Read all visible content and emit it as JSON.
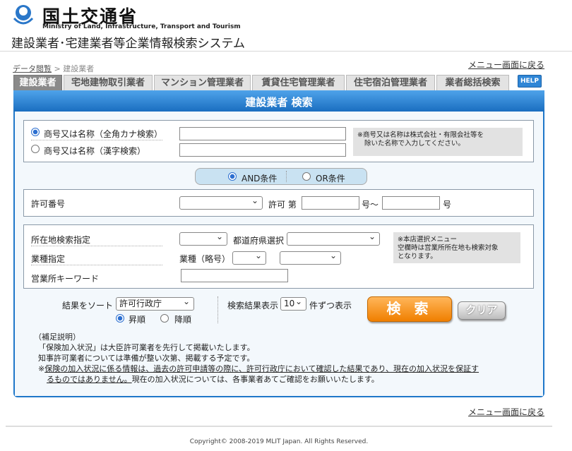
{
  "header": {
    "ministry_name": "国土交通省",
    "ministry_en": "Ministry of Land, Infrastructure, Transport and Tourism",
    "system_title": "建設業者･宅建業者等企業情報検索システム"
  },
  "nav": {
    "menu_link": "メニュー画面に戻る",
    "breadcrumb_root": "データ閲覧",
    "breadcrumb_sep": ">",
    "breadcrumb_current": "建設業者"
  },
  "tabs": [
    {
      "label": "建設業者"
    },
    {
      "label": "宅地建物取引業者"
    },
    {
      "label": "マンション管理業者"
    },
    {
      "label": "賃貸住宅管理業者"
    },
    {
      "label": "住宅宿泊管理業者"
    },
    {
      "label": "業者総括検索"
    }
  ],
  "help_label": "HELP",
  "panel_title": "建設業者 検索",
  "name_search": {
    "kana_label": "商号又は名称（全角カナ検索）",
    "kanji_label": "商号又は名称（漢字検索）",
    "kana_value": "",
    "kanji_value": "",
    "note_line1": "※商号又は名称は株式会社・有限会社等を",
    "note_line2": "除いた名称で入力してください。"
  },
  "condition": {
    "and_label": "AND条件",
    "or_label": "OR条件"
  },
  "permit": {
    "label": "許可番号",
    "select_value": "",
    "prefix": "許可 第",
    "from_value": "",
    "mid": "号〜",
    "to_value": "",
    "suffix": "号"
  },
  "location": {
    "label": "所在地検索指定",
    "pref_label": "都道府県選択",
    "industry_label": "業種指定",
    "industry_abbr_label": "業種（略号）",
    "keyword_label": "営業所キーワード",
    "keyword_value": "",
    "note_line1": "※本店選択メニュー",
    "note_line2": "空欄時は営業所所在地も検索対象",
    "note_line3": "となります。"
  },
  "sort": {
    "label": "結果をソート",
    "value": "許可行政庁",
    "asc_label": "昇順",
    "desc_label": "降順"
  },
  "results": {
    "label": "検索結果表示",
    "value": "10",
    "suffix": "件ずつ表示"
  },
  "buttons": {
    "search": "検 索",
    "clear": "クリア"
  },
  "notes": {
    "heading": "（補足説明）",
    "line1": "「保険加入状況」は大臣許可業者を先行して掲載いたします。",
    "line2": "知事許可業者については準備が整い次第、掲載する予定です。",
    "line3_prefix": "※",
    "line3_underlined": "保険の加入状況に係る情報は、過去の許可申請等の際に、許可行政庁において確認した結果であり、現在の加入状況を保証す",
    "line4_underlined": "るものではありません。",
    "line4_rest": "現在の加入状況については、各事業者あてご確認をお願いいたします。"
  },
  "footer": {
    "copyright": "Copyright© 2008-2019 MLIT Japan. All Rights Reserved."
  },
  "colors": {
    "panel_blue": "#1e77c9",
    "search_orange": "#f07f00"
  }
}
